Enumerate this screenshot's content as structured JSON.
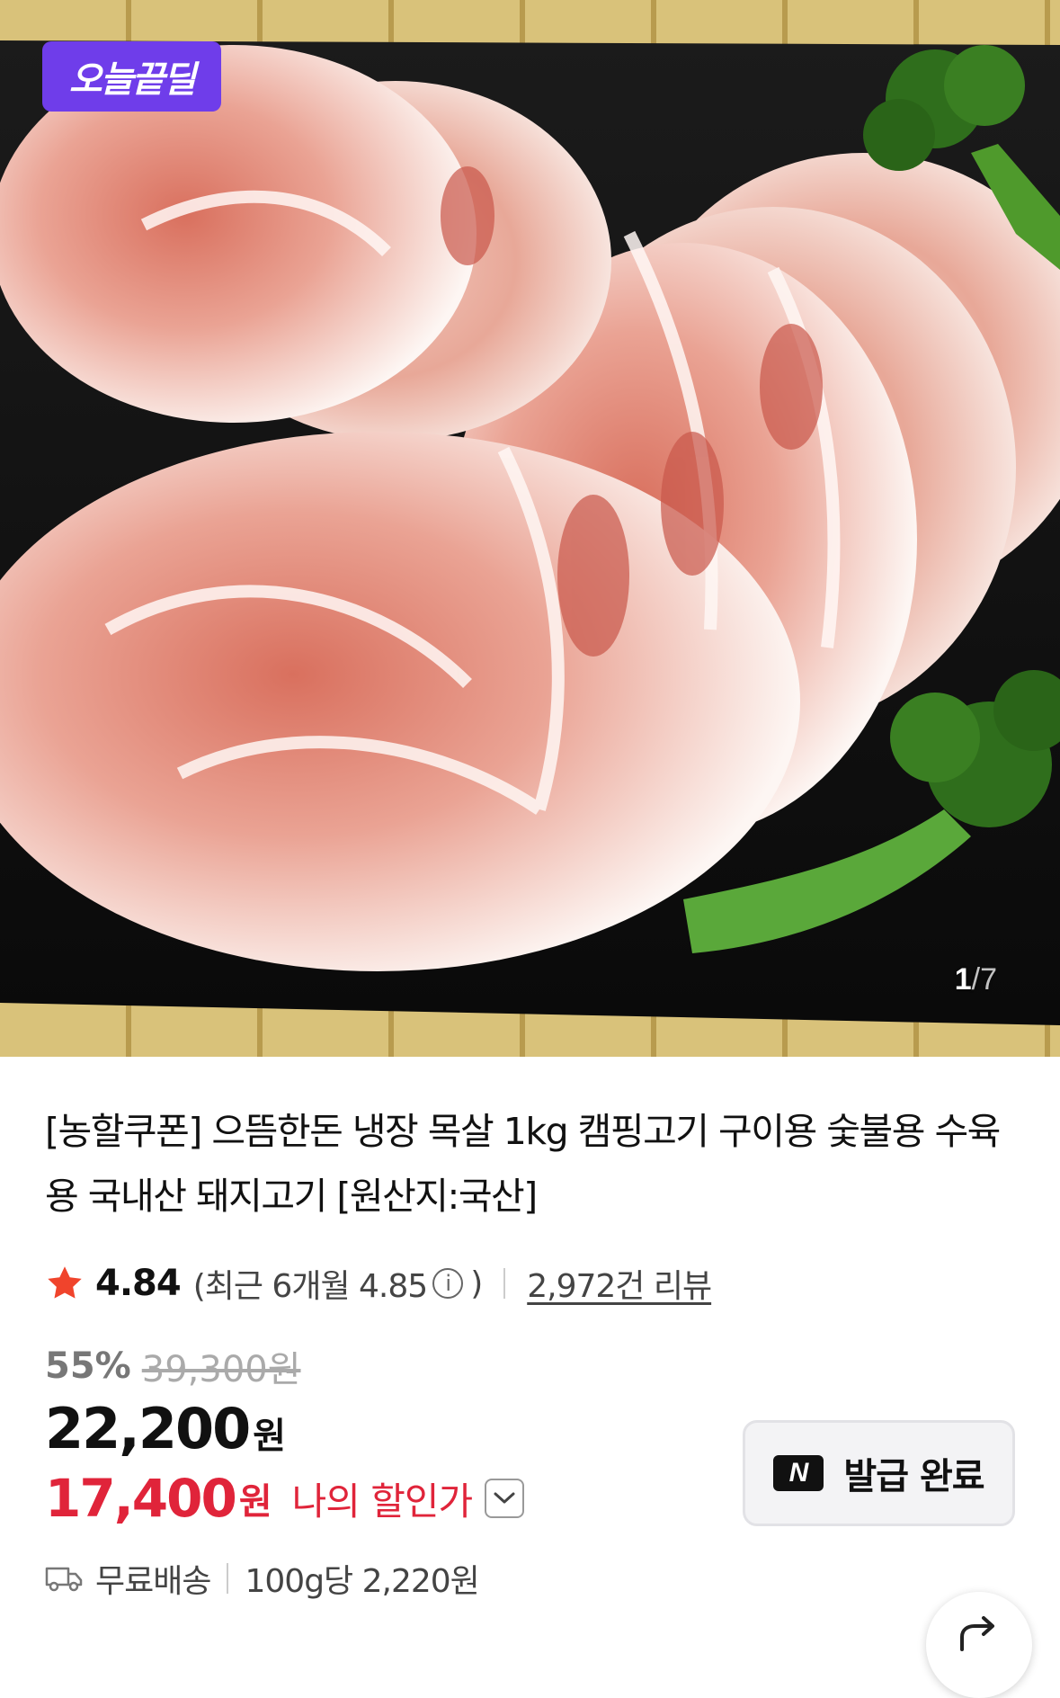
{
  "hero": {
    "badge": "오늘끝딜",
    "pager_current": "1",
    "pager_total": "/7"
  },
  "product": {
    "title": "[농할쿠폰] 으뜸한돈 냉장 목살 1kg 캠핑고기 구이용 숯불용 수육용 국내산 돼지고기 [원산지:국산]"
  },
  "rating": {
    "score": "4.84",
    "recent_text": "(최근 6개월 4.85",
    "recent_close": ")",
    "info_glyph": "i",
    "reviews": "2,972건 리뷰"
  },
  "price": {
    "discount": "55%",
    "original": "39,300원",
    "sale": "22,200",
    "sale_unit": "원",
    "my_price": "17,400",
    "my_unit": "원",
    "my_label": "나의 할인가"
  },
  "coupon": {
    "logo": "N",
    "label": "발급 완료"
  },
  "shipping": {
    "free": "무료배송",
    "unit_price": "100g당 2,220원"
  },
  "colors": {
    "badge": "#6f3dea",
    "star": "#f0442c",
    "my_price": "#e0243a"
  }
}
